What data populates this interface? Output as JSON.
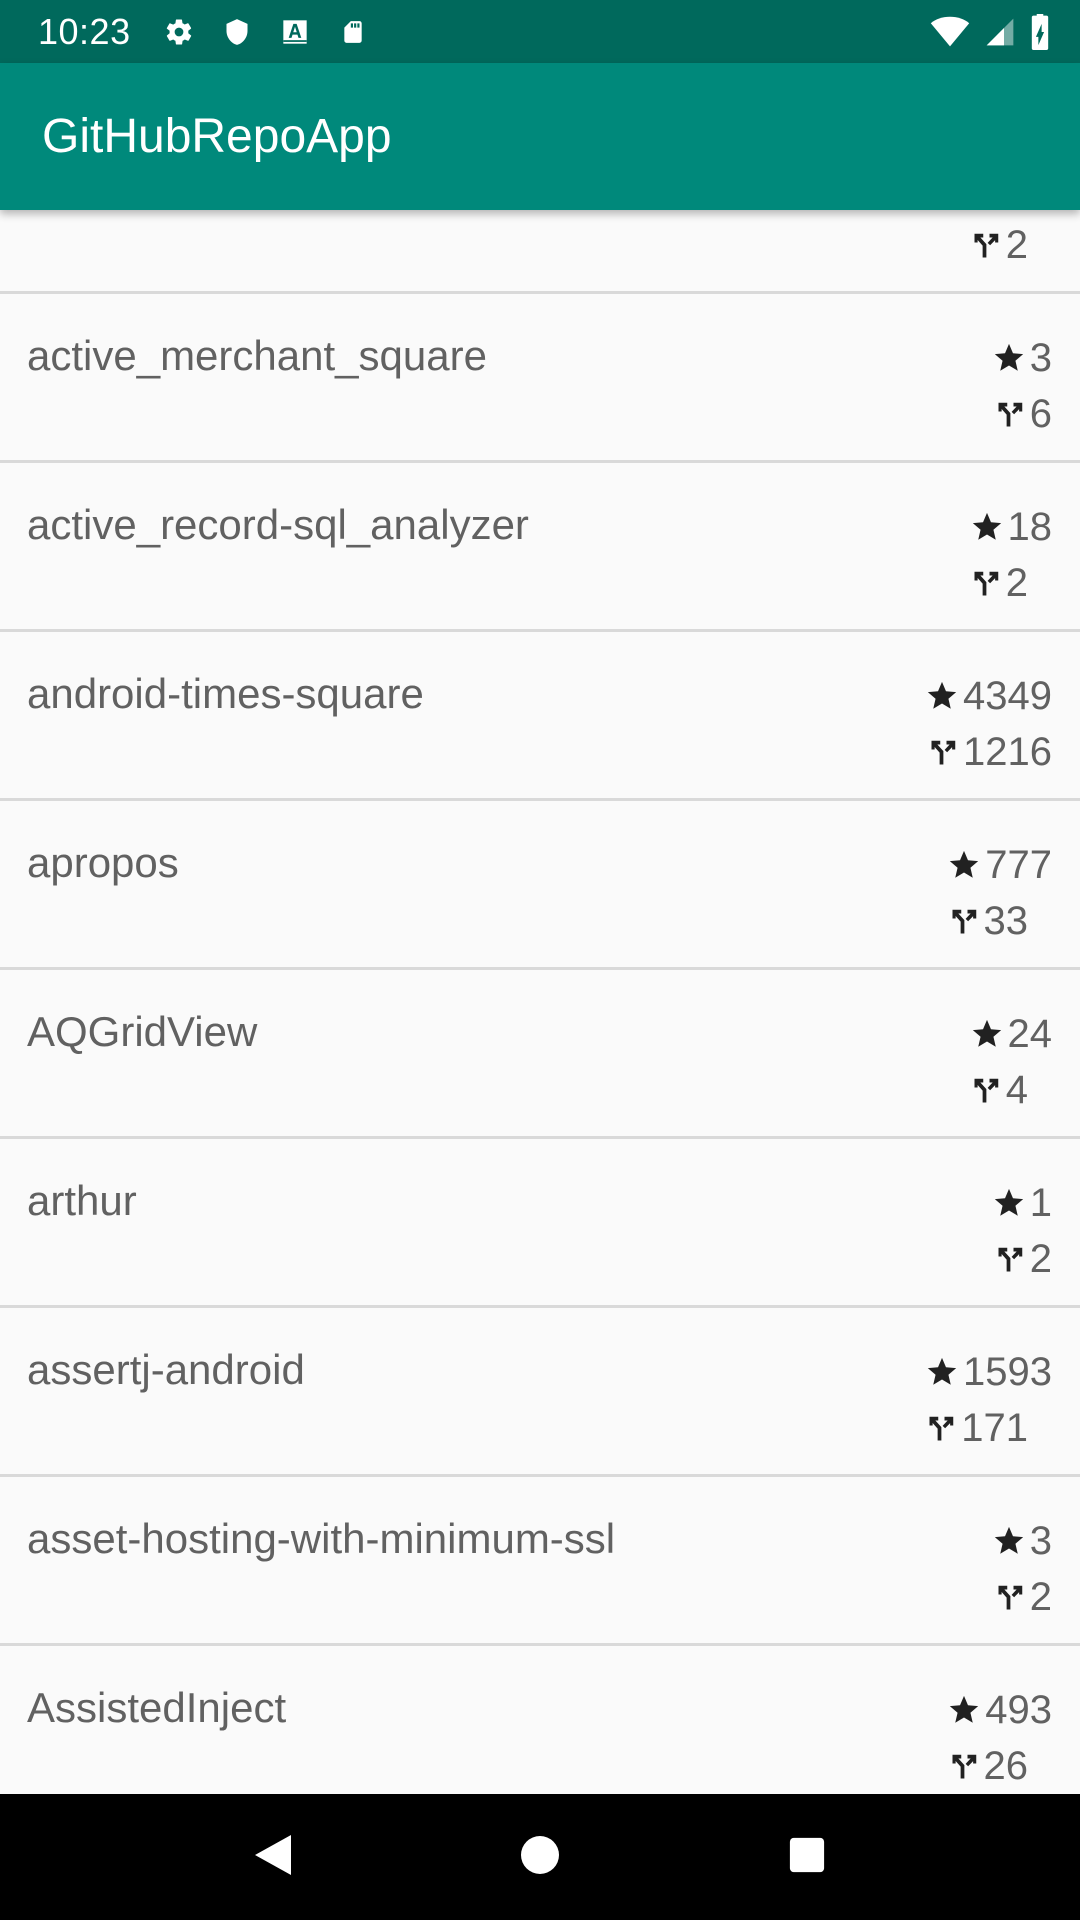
{
  "status_bar": {
    "time": "10:23",
    "icons_left": [
      "settings-icon",
      "shield-icon",
      "a-box-icon",
      "sd-card-icon"
    ],
    "icons_right": [
      "wifi-icon",
      "cell-signal-icon",
      "battery-charging-icon"
    ]
  },
  "app_bar": {
    "title": "GitHubRepoApp"
  },
  "icons": {
    "stars": "star-icon",
    "forks": "fork-icon"
  },
  "repos": [
    {
      "name": "",
      "stars": "",
      "forks": "2"
    },
    {
      "name": "active_merchant_square",
      "stars": "3",
      "forks": "6"
    },
    {
      "name": "active_record-sql_analyzer",
      "stars": "18",
      "forks": "2"
    },
    {
      "name": "android-times-square",
      "stars": "4349",
      "forks": "1216"
    },
    {
      "name": "apropos",
      "stars": "777",
      "forks": "33"
    },
    {
      "name": "AQGridView",
      "stars": "24",
      "forks": "4"
    },
    {
      "name": "arthur",
      "stars": "1",
      "forks": "2"
    },
    {
      "name": "assertj-android",
      "stars": "1593",
      "forks": "171"
    },
    {
      "name": "asset-hosting-with-minimum-ssl",
      "stars": "3",
      "forks": "2"
    },
    {
      "name": "AssistedInject",
      "stars": "493",
      "forks": "26"
    }
  ],
  "nav_bar": {
    "buttons": [
      "back-icon",
      "home-icon",
      "recents-icon"
    ]
  },
  "colors": {
    "status_bar": "#00695c",
    "app_bar": "#00897b",
    "text_secondary": "#616161",
    "divider": "#d9d9d9"
  }
}
